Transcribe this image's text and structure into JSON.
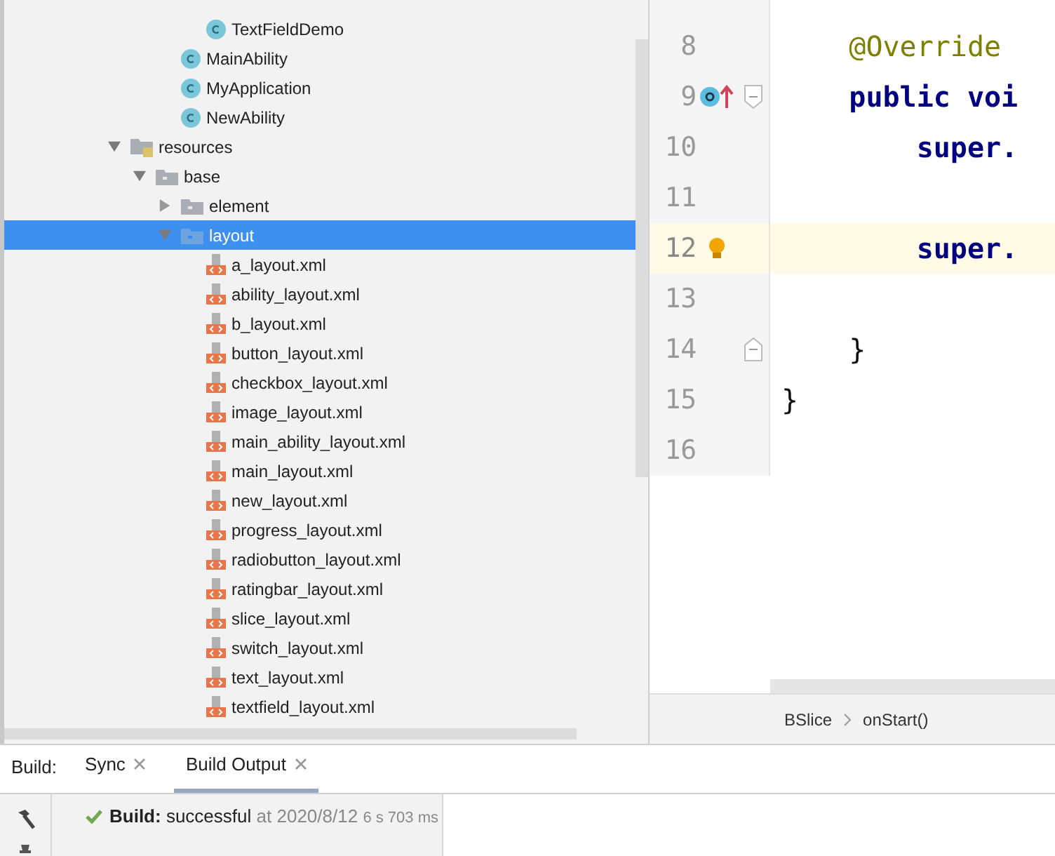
{
  "tree": [
    {
      "children": [
        {
          "children": [
            {
              "children": [
                {
                  "label": "TextFieldDemo",
                  "kind": "class",
                  "selected": false
                }
              ]
            },
            {
              "label": "MainAbility",
              "kind": "class",
              "selected": false
            },
            {
              "label": "MyApplication",
              "kind": "class",
              "selected": false
            },
            {
              "label": "NewAbility",
              "kind": "class",
              "selected": false
            }
          ]
        }
      ]
    },
    {
      "label": "resources",
      "kind": "resfolder",
      "expanded": true,
      "selected": false,
      "children": [
        {
          "label": "base",
          "kind": "folder",
          "expanded": true,
          "selected": false,
          "children": [
            {
              "label": "element",
              "kind": "folder",
              "expanded": false,
              "selected": false
            },
            {
              "label": "layout",
              "kind": "folder",
              "expanded": true,
              "selected": true,
              "children": [
                {
                  "label": "a_layout.xml",
                  "kind": "xml",
                  "selected": false
                },
                {
                  "label": "ability_layout.xml",
                  "kind": "xml",
                  "selected": false
                },
                {
                  "label": "b_layout.xml",
                  "kind": "xml",
                  "selected": false
                },
                {
                  "label": "button_layout.xml",
                  "kind": "xml",
                  "selected": false
                },
                {
                  "label": "checkbox_layout.xml",
                  "kind": "xml",
                  "selected": false
                },
                {
                  "label": "image_layout.xml",
                  "kind": "xml",
                  "selected": false
                },
                {
                  "label": "main_ability_layout.xml",
                  "kind": "xml",
                  "selected": false
                },
                {
                  "label": "main_layout.xml",
                  "kind": "xml",
                  "selected": false
                },
                {
                  "label": "new_layout.xml",
                  "kind": "xml",
                  "selected": false
                },
                {
                  "label": "progress_layout.xml",
                  "kind": "xml",
                  "selected": false
                },
                {
                  "label": "radiobutton_layout.xml",
                  "kind": "xml",
                  "selected": false
                },
                {
                  "label": "ratingbar_layout.xml",
                  "kind": "xml",
                  "selected": false
                },
                {
                  "label": "slice_layout.xml",
                  "kind": "xml",
                  "selected": false
                },
                {
                  "label": "switch_layout.xml",
                  "kind": "xml",
                  "selected": false
                },
                {
                  "label": "text_layout.xml",
                  "kind": "xml",
                  "selected": false
                },
                {
                  "label": "textfield_layout.xml",
                  "kind": "xml",
                  "selected": false
                }
              ]
            }
          ]
        }
      ]
    }
  ],
  "editor": {
    "lines": [
      {
        "number": "8",
        "current": false,
        "segments": [
          {
            "kind": "annotation",
            "text": "    @Override"
          }
        ]
      },
      {
        "number": "9",
        "current": false,
        "marker": {
          "kind": "override"
        },
        "fold": {
          "kind": "start"
        },
        "segments": [
          {
            "kind": "keyword",
            "text": "    public voi"
          }
        ]
      },
      {
        "number": "10",
        "current": false,
        "segments": [
          {
            "kind": "keyword",
            "text": "        super."
          }
        ]
      },
      {
        "number": "11",
        "current": false
      },
      {
        "number": "12",
        "current": true,
        "marker": {
          "kind": "bulb"
        },
        "segments": [
          {
            "kind": "keyword",
            "text": "        super."
          }
        ]
      },
      {
        "number": "13",
        "current": false
      },
      {
        "number": "14",
        "current": false,
        "fold": {
          "kind": "end"
        },
        "segments": [
          {
            "kind": "plain",
            "text": "    }"
          }
        ]
      },
      {
        "number": "15",
        "current": false,
        "segments": [
          {
            "kind": "plain",
            "text": "}"
          }
        ]
      },
      {
        "number": "16",
        "current": false
      }
    ],
    "breadcrumb": [
      "BSlice",
      "onStart()"
    ]
  },
  "build": {
    "label": "Build:",
    "tabs": [
      {
        "label": "Sync",
        "selected": false
      },
      {
        "label": "Build Output",
        "selected": true
      }
    ],
    "result": {
      "title": "Build:",
      "status": "successful",
      "time": "at 2020/8/12",
      "duration": "6 s 703 ms"
    }
  }
}
